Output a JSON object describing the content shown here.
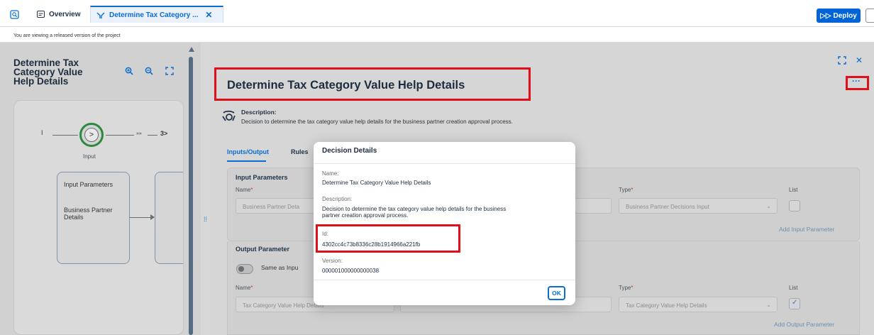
{
  "tabs": {
    "overview": "Overview",
    "active": "Determine Tax Category ...",
    "deploy": "Deploy"
  },
  "info_bar": "You are viewing a released version of the project",
  "left": {
    "title_lines": [
      "Determine Tax",
      "Category Value",
      "Help Details"
    ],
    "start_label": "Input",
    "flow_start_marker": "I",
    "flow_end_marker": "3>",
    "node_input_params": "Input Parameters",
    "node_bp_details": "Business Partner Details"
  },
  "main": {
    "title": "Determine Tax Category Value Help Details",
    "description_label": "Description:",
    "description_text": "Decision to determine the tax category value help details for the business partner creation approval process.",
    "tab_io": "Inputs/Output",
    "tab_rules": "Rules",
    "input_section": "Input Parameters",
    "name_label": "Name",
    "type_label": "Type",
    "list_label": "List",
    "input_name_value": "Business Partner Deta",
    "input_type_value": "Business Partner Decisions Input",
    "add_input": "Add Input Parameter",
    "output_section": "Output Parameter",
    "same_as_input": "Same as Inpu",
    "output_name_value": "Tax Category Value Help Details",
    "output_type_value": "Tax Category Value Help Details",
    "add_output": "Add Output Parameter"
  },
  "dialog": {
    "title": "Decision Details",
    "name_label": "Name:",
    "name_value": "Determine Tax Category Value Help Details",
    "description_label": "Description:",
    "description_line1": "Decision to determine the tax category value help details for the business",
    "description_line2": "partner creation approval process.",
    "id_label": "Id:",
    "id_value": "4302cc4c73b8336c28b1914966a221fb",
    "version_label": "Version:",
    "version_value": "000001000000000038",
    "ok": "OK"
  },
  "colors": {
    "accent": "#0a6ed1",
    "highlight": "#e0101a",
    "start_ring": "#2b8a3e"
  }
}
